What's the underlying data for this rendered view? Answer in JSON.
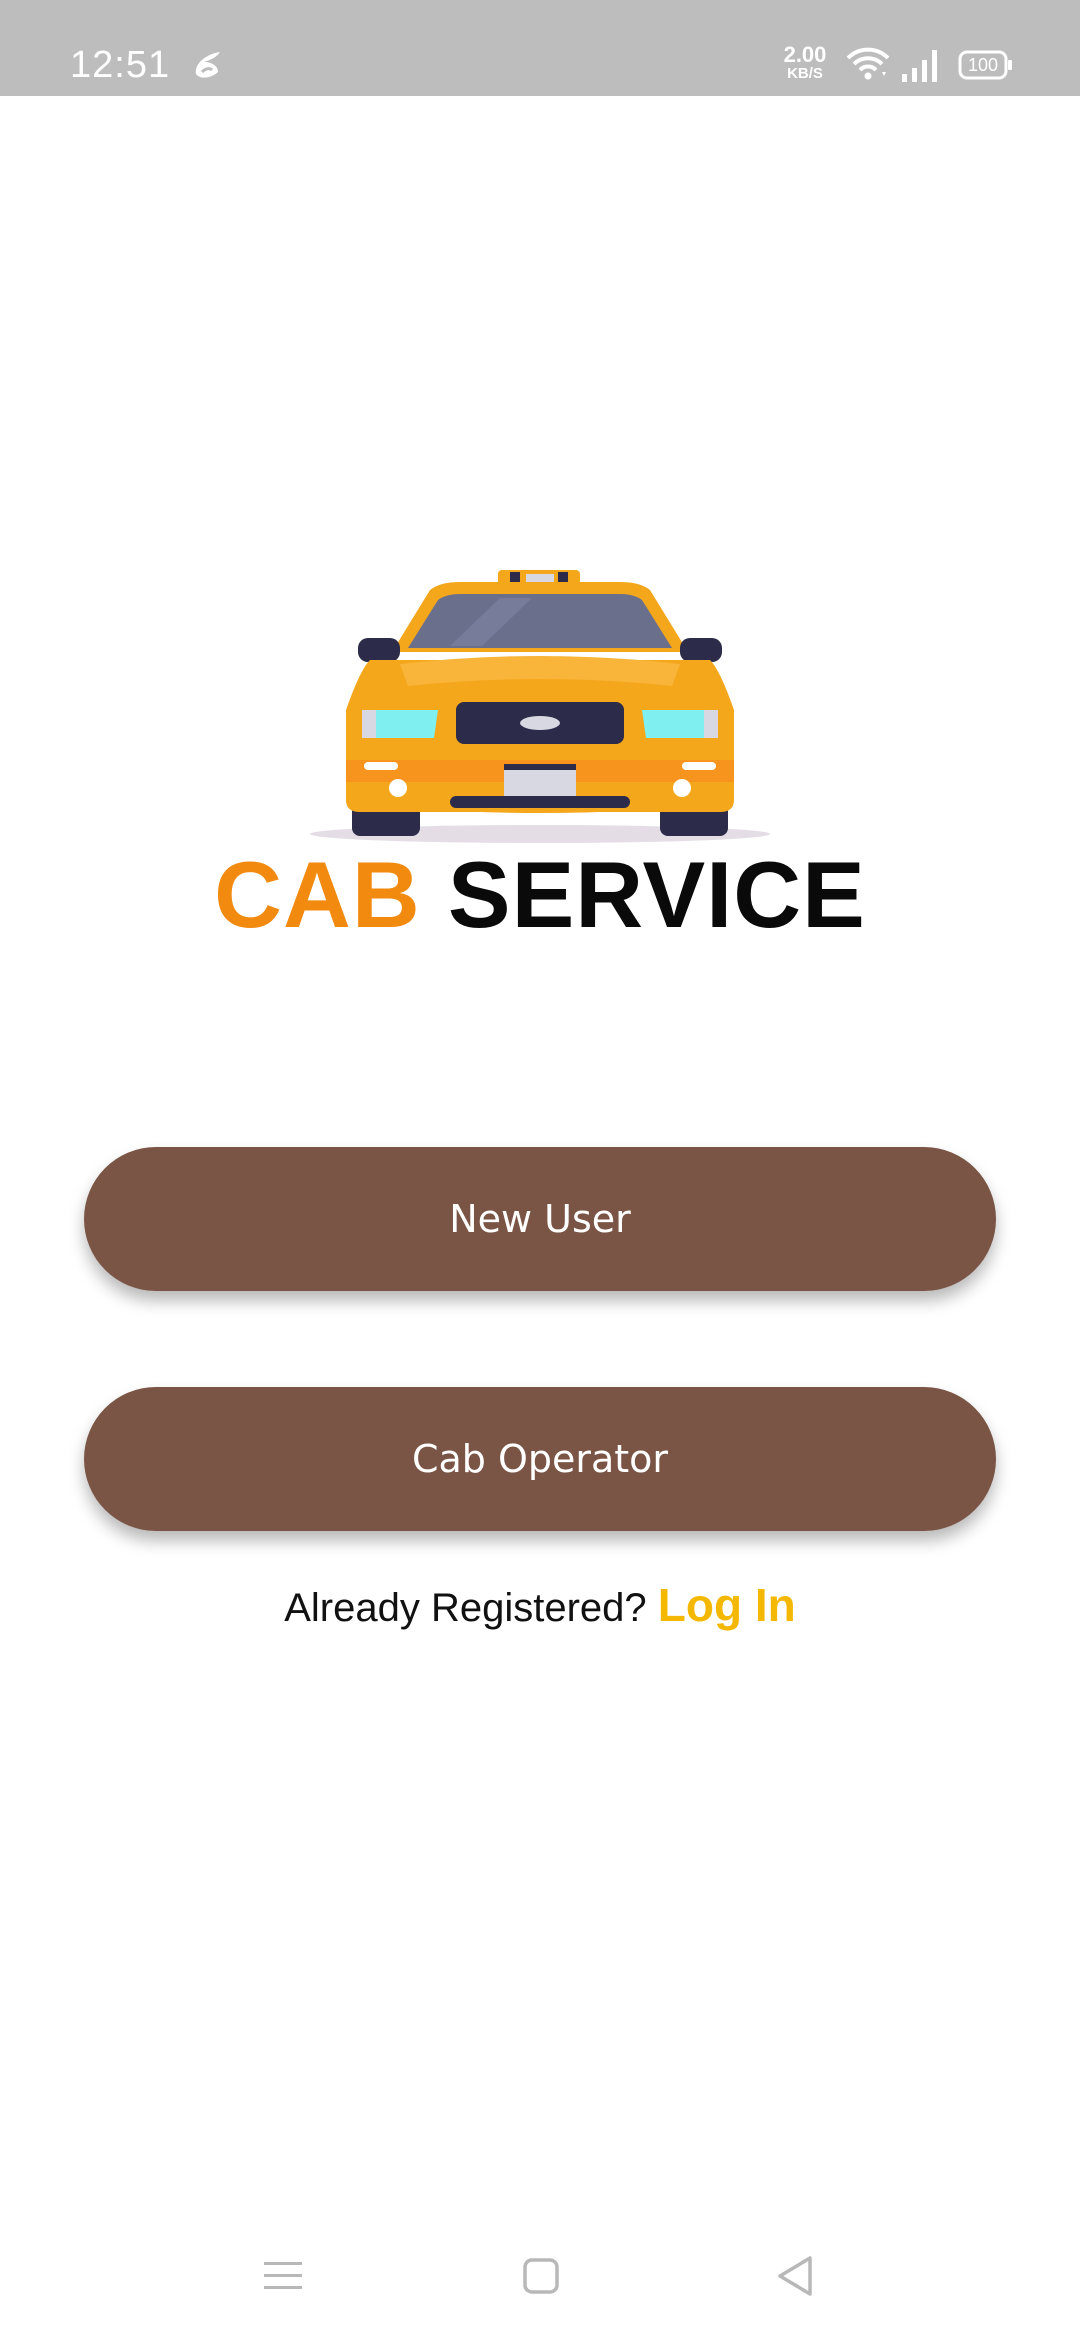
{
  "status_bar": {
    "time": "12:51",
    "net_speed_value": "2.00",
    "net_speed_unit": "KB/S",
    "battery_level": "100",
    "icons": [
      "app-notification-icon",
      "wifi-icon",
      "signal-icon",
      "battery-icon"
    ]
  },
  "hero": {
    "image": "taxi-car-illustration",
    "colors": {
      "body": "#f5a71c",
      "windshield": "#6a6f8c",
      "lights": "#7ff0ef"
    }
  },
  "brand": {
    "word1": "CAB",
    "word2": "SERVICE",
    "word1_color": "#f28a10",
    "word2_color": "#0a0a0a"
  },
  "actions": {
    "new_user_label": "New User",
    "cab_operator_label": "Cab Operator",
    "button_color": "#7a5546"
  },
  "login": {
    "prompt": "Already Registered? ",
    "link_label": "Log In",
    "link_color": "#f5b800"
  },
  "nav_bar": {
    "icons": [
      "menu-icon",
      "home-icon",
      "back-icon"
    ]
  }
}
